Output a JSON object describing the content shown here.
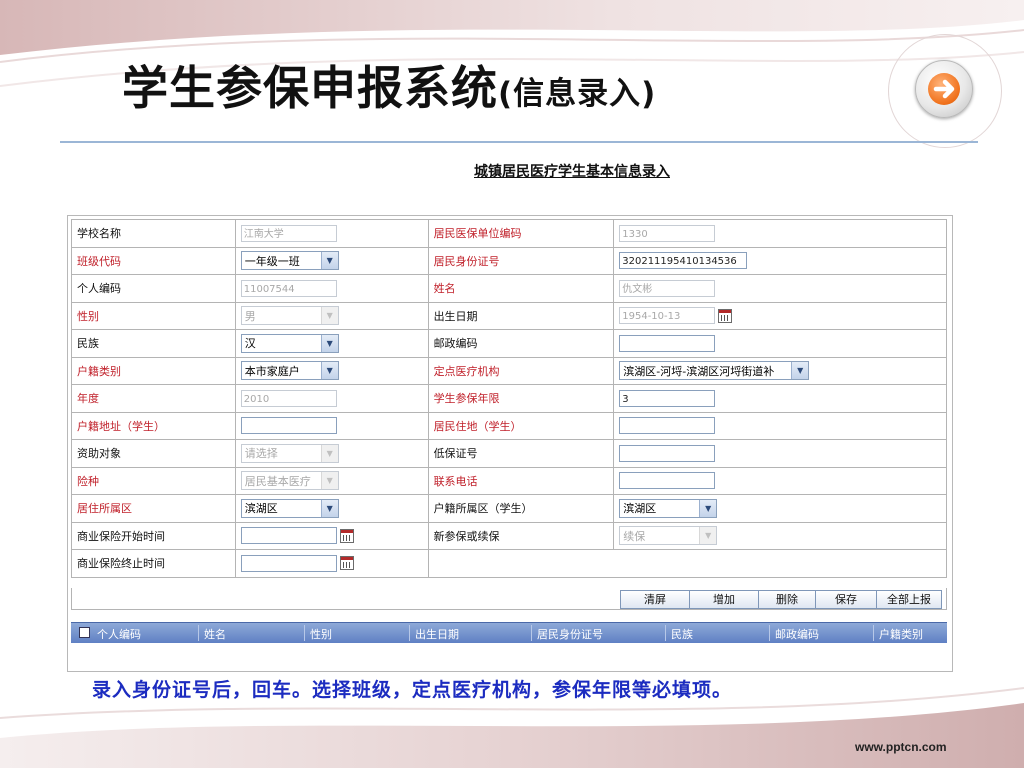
{
  "slide": {
    "title_main": "学生参保申报系统",
    "title_sub": "(信息录入)",
    "next_icon": "arrow-right-icon",
    "note": "录入身份证号后，回车。选择班级，定点医疗机构，参保年限等必填项。",
    "footer": "www.pptcn.com"
  },
  "form": {
    "heading": "城镇居民医疗学生基本信息录入",
    "rows": [
      {
        "l1": "学校名称",
        "v1": "江南大学",
        "l2": "居民医保单位编码",
        "v2": "1330"
      },
      {
        "l1": "班级代码",
        "v1": "一年级一班",
        "l2": "居民身份证号",
        "v2": "320211195410134536"
      },
      {
        "l1": "个人编码",
        "v1": "11007544",
        "l2": "姓名",
        "v2": "仇文彬"
      },
      {
        "l1": "性别",
        "v1": "男",
        "l2": "出生日期",
        "v2": "1954-10-13"
      },
      {
        "l1": "民族",
        "v1": "汉",
        "l2": "邮政编码",
        "v2": ""
      },
      {
        "l1": "户籍类别",
        "v1": "本市家庭户",
        "l2": "定点医疗机构",
        "v2": "滨湖区-河埒-滨湖区河埒街道补"
      },
      {
        "l1": "年度",
        "v1": "2010",
        "l2": "学生参保年限",
        "v2": "3"
      },
      {
        "l1": "户籍地址（学生）",
        "v1": "",
        "l2": "居民住地（学生）",
        "v2": ""
      },
      {
        "l1": "资助对象",
        "v1": "请选择",
        "l2": "低保证号",
        "v2": ""
      },
      {
        "l1": "险种",
        "v1": "居民基本医疗",
        "l2": "联系电话",
        "v2": ""
      },
      {
        "l1": "居住所属区",
        "v1": "滨湖区",
        "l2": "户籍所属区（学生）",
        "v2": "滨湖区"
      },
      {
        "l1": "商业保险开始时间",
        "v1": "",
        "l2": "新参保或续保",
        "v2": "续保"
      },
      {
        "l1": "商业保险终止时间",
        "v1": ""
      }
    ],
    "buttons": [
      "清屏",
      "增加",
      "删除",
      "保存",
      "全部上报"
    ],
    "grid_columns": [
      "个人编码",
      "姓名",
      "性别",
      "出生日期",
      "居民身份证号",
      "民族",
      "邮政编码",
      "户籍类别"
    ]
  }
}
